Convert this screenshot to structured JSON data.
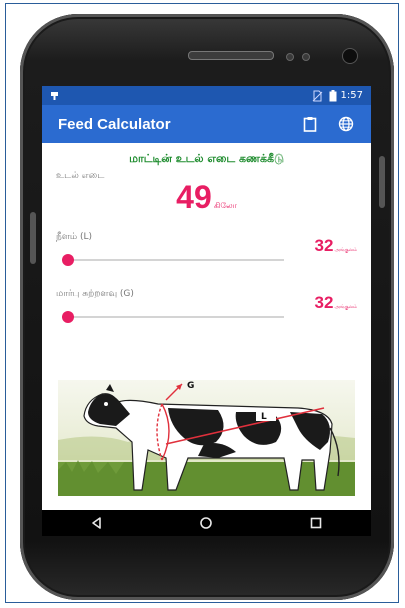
{
  "status_bar": {
    "time": "1:57",
    "icons": [
      "notification-icon",
      "no-sim-icon",
      "battery-icon"
    ]
  },
  "app_bar": {
    "title": "Feed Calculator",
    "actions": [
      "clipboard-icon",
      "globe-icon"
    ]
  },
  "main": {
    "heading": "மாட்டின் உடல் எடை கணக்கீடு",
    "weight_label": "உடல் எடை",
    "weight_value": "49",
    "weight_unit": "கிலோ",
    "length": {
      "label": "நீளம் (L)",
      "value": "32",
      "unit": "அங்குலம்",
      "level": 0
    },
    "girth": {
      "label": "மார்பு சுற்றளவு (G)",
      "value": "32",
      "unit": "அங்குலம்",
      "level": 0
    },
    "diagram": {
      "girth_marker": "G",
      "length_marker": "L"
    }
  },
  "nav_bar": {
    "buttons": [
      "back-icon",
      "home-icon",
      "recents-icon"
    ]
  },
  "colors": {
    "status_bar": "#1e57b0",
    "app_bar": "#2b6bd0",
    "accent": "#e81e63",
    "heading": "#1e8c2e"
  }
}
